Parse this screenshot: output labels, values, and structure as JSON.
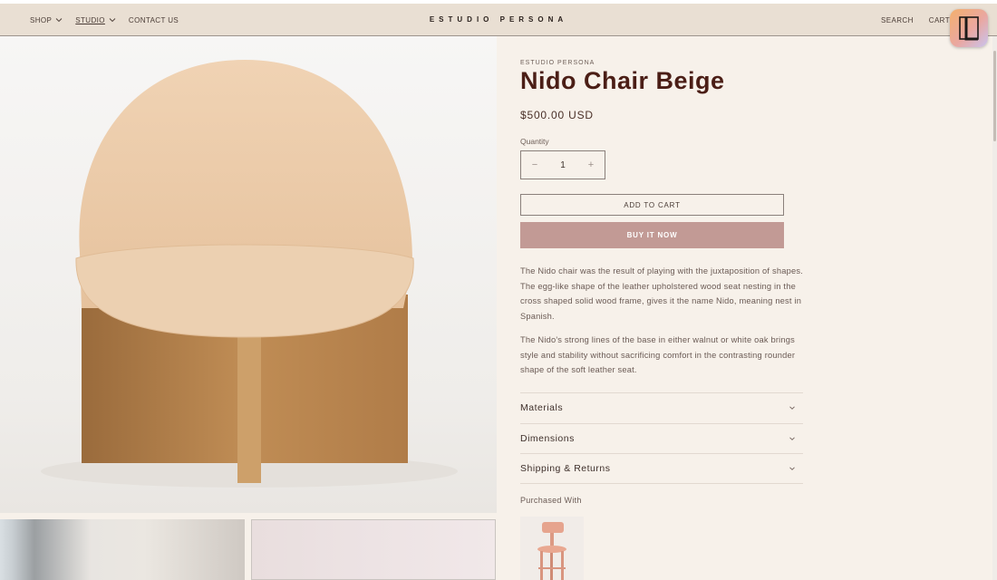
{
  "nav": {
    "items": [
      {
        "label": "SHOP",
        "has_dropdown": true
      },
      {
        "label": "STUDIO",
        "has_dropdown": true,
        "active": true
      },
      {
        "label": "CONTACT US",
        "has_dropdown": false
      }
    ]
  },
  "header": {
    "logo": "ESTUDIO PERSONA",
    "search": "SEARCH",
    "cart": "CART"
  },
  "product": {
    "vendor": "ESTUDIO PERSONA",
    "title": "Nido Chair Beige",
    "price": "$500.00 USD",
    "quantity_label": "Quantity",
    "quantity_value": "1",
    "decrement_symbol": "−",
    "increment_symbol": "+",
    "add_to_cart": "ADD TO CART",
    "buy_now": "BUY IT NOW",
    "description": [
      "The Nido chair was the result of playing with the juxtaposition of shapes. The egg-like shape of the leather upholstered wood seat nesting in the cross shaped solid wood frame, gives it the name Nido, meaning nest in Spanish.",
      "The Nido's strong lines of the base in either walnut or white oak brings style and stability without sacrificing comfort in the contrasting rounder shape of the soft leather seat."
    ],
    "accordion": [
      {
        "label": "Materials"
      },
      {
        "label": "Dimensions"
      },
      {
        "label": "Shipping & Returns"
      }
    ],
    "purchased_with_label": "Purchased With"
  },
  "colors": {
    "header_bg": "#e9dfd3",
    "page_bg": "#f7f1ea",
    "title": "#4b1e16",
    "buy_button": "#c29a95"
  },
  "icons": [
    "chevron-down-icon",
    "app-badge-icon"
  ]
}
